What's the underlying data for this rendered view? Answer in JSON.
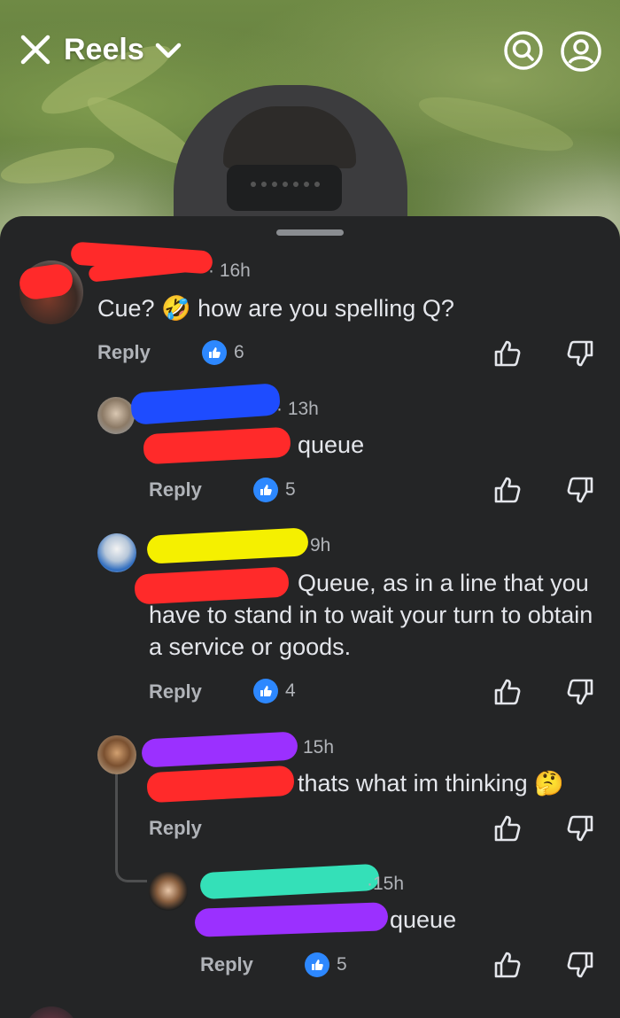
{
  "header": {
    "title": "Reels"
  },
  "colors": {
    "sheet_bg": "#242526",
    "like_blue": "#2d88ff",
    "redact_red": "#ff2a2a",
    "redact_blue": "#1e4cff",
    "redact_yellow": "#f5f000",
    "redact_purple": "#9b30ff",
    "redact_teal": "#34e0b8"
  },
  "comments": [
    {
      "time": "· 16h",
      "text": "Cue? 🤣 how are you spelling Q?",
      "reply_label": "Reply",
      "likes": "6"
    },
    {
      "time": "· 13h",
      "text": "queue",
      "reply_label": "Reply",
      "likes": "5"
    },
    {
      "time": "9h",
      "text": "Queue, as in a line that you have to stand in to wait your turn to obtain a service or goods.",
      "reply_label": "Reply",
      "likes": "4"
    },
    {
      "time": "15h",
      "text": "thats what im thinking 🤔",
      "reply_label": "Reply"
    },
    {
      "time": "·15h",
      "text": "queue",
      "reply_label": "Reply",
      "likes": "5"
    }
  ],
  "icons": {
    "close": "close-icon",
    "chevron": "chevron-down-icon",
    "search": "search-icon",
    "profile": "profile-icon",
    "like": "thumbs-up-icon",
    "dislike": "thumbs-down-icon"
  }
}
